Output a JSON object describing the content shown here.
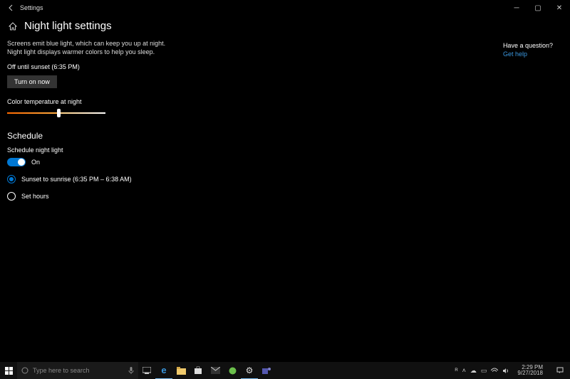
{
  "titlebar": {
    "title": "Settings"
  },
  "page": {
    "title": "Night light settings"
  },
  "desc": "Screens emit blue light, which can keep you up at night. Night light displays warmer colors to help you sleep.",
  "status": "Off until sunset (6:35 PM)",
  "button": "Turn on now",
  "temp_label": "Color temperature at night",
  "schedule": {
    "heading": "Schedule",
    "toggle_label": "Schedule night light",
    "toggle_state": "On",
    "radio1": "Sunset to sunrise (6:35 PM – 6:38 AM)",
    "radio2": "Set hours"
  },
  "help": {
    "question": "Have a question?",
    "link": "Get help"
  },
  "taskbar": {
    "search_placeholder": "Type here to search",
    "time": "2:29 PM",
    "date": "9/27/2018"
  }
}
